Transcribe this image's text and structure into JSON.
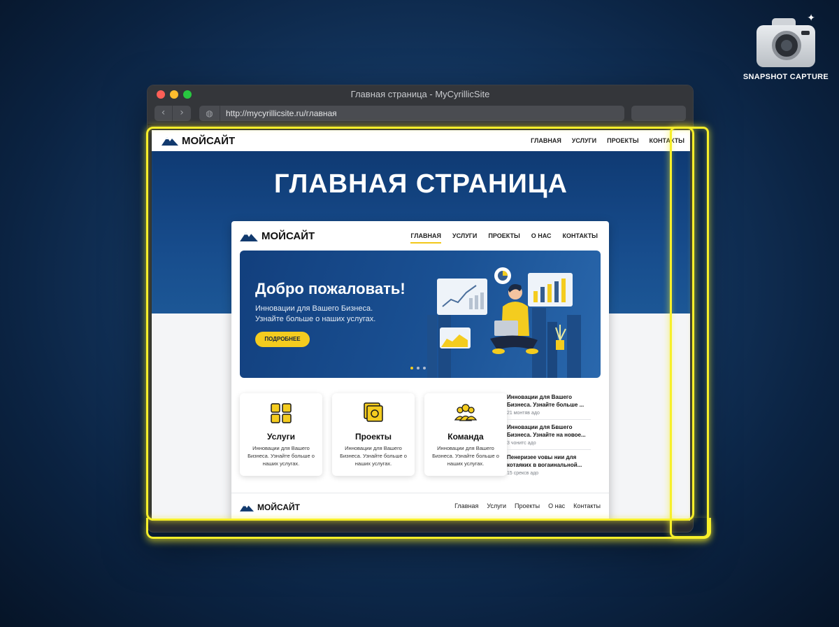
{
  "badge": {
    "label": "SNAPSHOT CAPTURE",
    "icon": "camera-icon"
  },
  "window": {
    "title": "Главная страница - MyCyrillicSite",
    "url": "http://mycyrillicsite.ru/главная"
  },
  "site": {
    "logo": "МОЙСАЙТ",
    "topnav": [
      "ГЛАВНАЯ",
      "УСЛУГИ",
      "ПРОЕКТЫ",
      "КОНТАКТЫ"
    ],
    "hero_title": "ГЛАВНАЯ СТРАНИЦА"
  },
  "inner": {
    "logo": "МОЙСАЙТ",
    "nav": [
      "ГЛАВНАЯ",
      "УСЛУГИ",
      "ПРОЕКТЫ",
      "О НАС",
      "КОНТАКТЫ"
    ],
    "active_nav": "ГЛАВНАЯ",
    "banner": {
      "title": "Добро пожаловать!",
      "line1": "Инновации для Вашего Бизнеса.",
      "line2": "Узнайте больше о наших услугах.",
      "button": "ПОДРОБНЕЕ"
    },
    "features": [
      {
        "title": "Услуги",
        "text": "Инновации для Вашего Бизнеса. Узнайте больше о наших услугах.",
        "icon": "services-grid-icon"
      },
      {
        "title": "Проекты",
        "text": "Инновации для Вашего Бизнеса. Узнайте больше о наших услугах.",
        "icon": "projects-stack-icon"
      },
      {
        "title": "Команда",
        "text": "Инновации для Вашего Бизнеса. Узнайте больше о наших услугах.",
        "icon": "team-icon"
      }
    ],
    "news": [
      {
        "title": "Инновации для Вашего Бизнеса. Узнайте больше ...",
        "time": "21 монтяв адо"
      },
      {
        "title": "Инновации для Бвшего Бизнеса. Узнайте на новое...",
        "time": "3 чонитс адо"
      },
      {
        "title": "Пенеризее voвы нии для котаякиx в вогаинальной...",
        "time": "15 срексв адо"
      }
    ],
    "footer": {
      "logo": "МОЙСАЙТ",
      "links": [
        "Главная",
        "Услуги",
        "Проекты",
        "О нас",
        "Контакты"
      ]
    }
  },
  "colors": {
    "accent": "#f4cc1f",
    "hero_blue": "#174c8c",
    "highlight": "#f7ef2a"
  }
}
